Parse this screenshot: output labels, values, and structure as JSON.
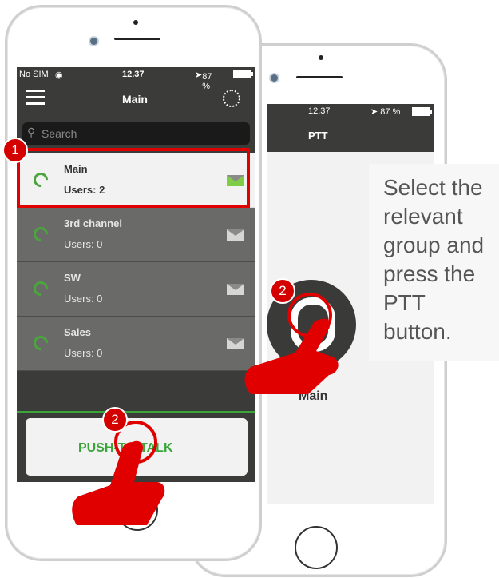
{
  "front_phone": {
    "status": {
      "carrier": "No SIM",
      "time": "12.37",
      "battery": "87 %"
    },
    "header": {
      "title": "Main"
    },
    "search": {
      "placeholder": "Search"
    },
    "channels": [
      {
        "name": "Main",
        "users": "Users: 2",
        "selected": true
      },
      {
        "name": "3rd channel",
        "users": "Users: 0",
        "selected": false
      },
      {
        "name": "SW",
        "users": "Users: 0",
        "selected": false
      },
      {
        "name": "Sales",
        "users": "Users: 0",
        "selected": false
      }
    ],
    "ptt_button": {
      "label": "PUSH-TO-TALK"
    }
  },
  "back_phone": {
    "status": {
      "time": "12.37",
      "battery": "87 %"
    },
    "header": {
      "title": "PTT"
    },
    "channel_label": "Main"
  },
  "callout": {
    "text": "Select the relevant group and press the PTT button."
  },
  "badges": {
    "step1": "1",
    "step2a": "2",
    "step2b": "2"
  },
  "colors": {
    "highlight": "#e00000",
    "accent_green": "#3aa63a",
    "row_bg": "#6a6a68",
    "topbar": "#3b3b3a"
  }
}
